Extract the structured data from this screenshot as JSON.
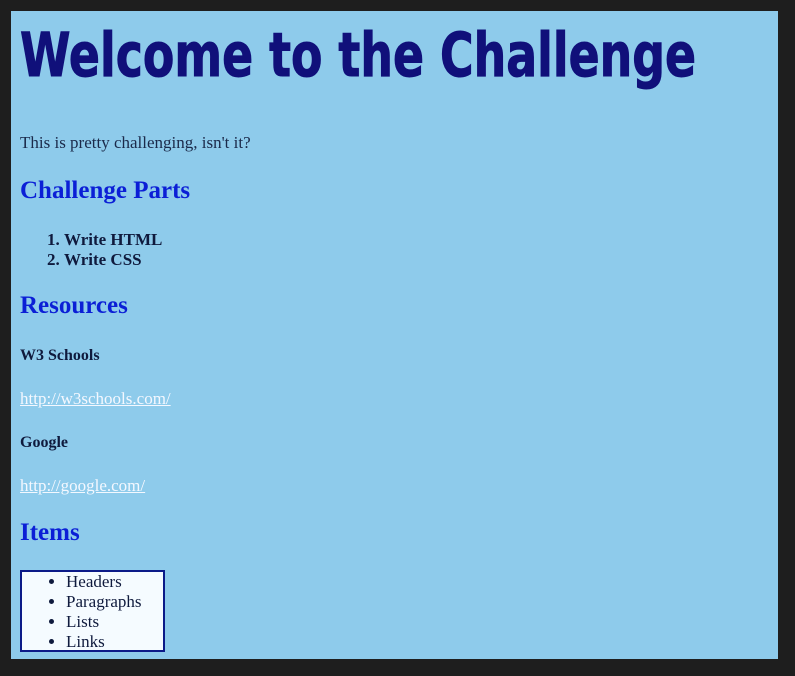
{
  "page": {
    "title": "Welcome to the Challenge",
    "intro": "This is pretty challenging, isn't it?"
  },
  "sections": {
    "parts_heading": "Challenge Parts",
    "parts": [
      "Write HTML",
      "Write CSS"
    ],
    "resources_heading": "Resources",
    "resources": [
      {
        "name": "W3 Schools",
        "url": "http://w3schools.com/"
      },
      {
        "name": "Google",
        "url": "http://google.com/"
      }
    ],
    "items_heading": "Items",
    "items": [
      "Headers",
      "Paragraphs",
      "Lists",
      "Links"
    ]
  },
  "colors": {
    "background": "#8ecbeb",
    "title": "#10107a",
    "headings": "#0b1fd6",
    "link": "#f4f8ff",
    "box_border": "#0b1a88"
  }
}
